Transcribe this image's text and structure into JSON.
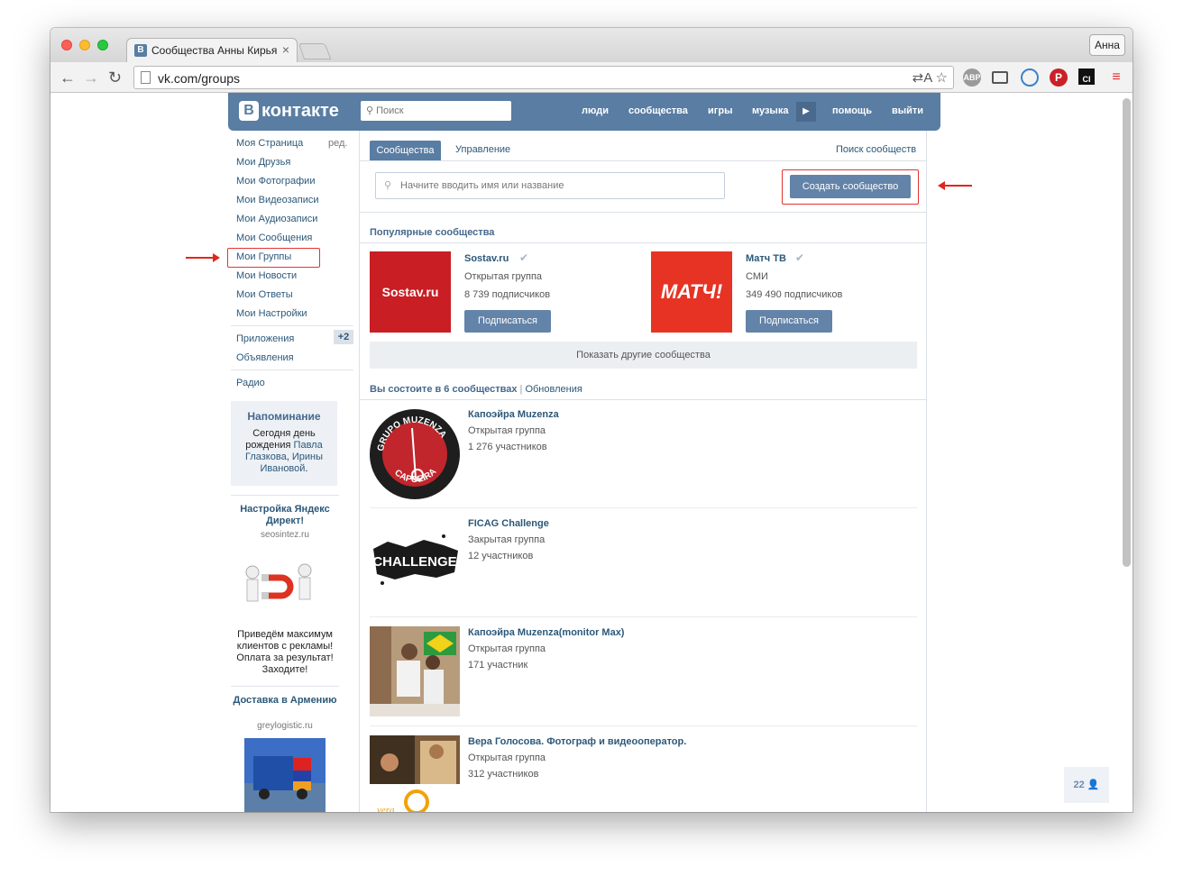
{
  "browser": {
    "tab_title": "Сообщества Анны Кирьянов",
    "tab_favicon": "В",
    "url": "vk.com/groups",
    "profile_name": "Анна",
    "ext_abp": "ABP",
    "ext_ci": "CI"
  },
  "vk": {
    "logo": "контакте",
    "logo_b": "В",
    "search_placeholder": "Поиск",
    "nav": [
      "люди",
      "сообщества",
      "игры",
      "музыка",
      "помощь",
      "выйти"
    ]
  },
  "left_menu": {
    "edit": "ред.",
    "items": [
      "Моя Страница",
      "Мои Друзья",
      "Мои Фотографии",
      "Мои Видеозаписи",
      "Мои Аудиозаписи",
      "Мои Сообщения",
      "Мои Группы",
      "Мои Новости",
      "Мои Ответы",
      "Мои Настройки"
    ],
    "apps": "Приложения",
    "apps_badge": "+2",
    "ads": "Объявления",
    "radio": "Радио"
  },
  "reminder": {
    "title": "Напоминание",
    "text_1": "Сегодня день рождения",
    "name_1": "Павла Глазкова",
    "sep": ",",
    "name_2": "Ирины Ивановой",
    "end": "."
  },
  "ad1": {
    "title": "Настройка Яндекс Директ!",
    "domain": "seosintez.ru",
    "text": "Приведём максимум клиентов с рекламы! Оплата за результат! Заходите!"
  },
  "ad2": {
    "title": "Доставка в Армению",
    "domain": "greylogistic.ru"
  },
  "content": {
    "tab_communities": "Сообщества",
    "tab_manage": "Управление",
    "search_communities": "Поиск сообществ",
    "search_placeholder": "Начните вводить имя или название",
    "create_button": "Создать сообщество",
    "popular_title": "Популярные сообщества",
    "popular": [
      {
        "name": "Sostav.ru",
        "type": "Открытая группа",
        "subs": "8 739 подписчиков",
        "logo": "Sostav.ru",
        "button": "Подписаться"
      },
      {
        "name": "Матч ТВ",
        "type": "СМИ",
        "subs": "349 490 подписчиков",
        "logo": "МАТЧ!",
        "button": "Подписаться"
      }
    ],
    "show_more": "Показать другие сообщества",
    "member_title": "Вы состоите в 6 сообществах",
    "updates": "Обновления",
    "groups": [
      {
        "name": "Капоэйра Muzenza",
        "type": "Открытая группа",
        "count": "1 276 участников",
        "logo_top": "GRUPO MUZENZA",
        "logo_bottom": "CAPOEIRA"
      },
      {
        "name": "FICAG Challenge",
        "type": "Закрытая группа",
        "count": "12 участников",
        "logo": "CHALLENGE"
      },
      {
        "name": "Капоэйра Muzenza(monitor Max)",
        "type": "Открытая группа",
        "count": "171 участник"
      },
      {
        "name": "Вера Голосова. Фотограф и видеооператор.",
        "type": "Открытая группа",
        "count": "312 участников",
        "logo": "vera"
      }
    ]
  },
  "online_counter": "22"
}
